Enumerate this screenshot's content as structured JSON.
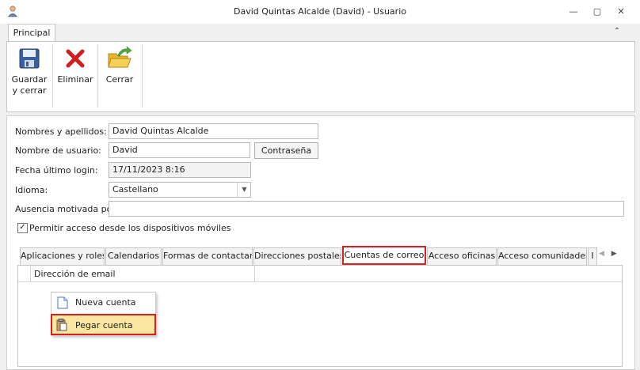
{
  "window": {
    "title": "David Quintas Alcalde (David) - Usuario",
    "minimize_icon": "minimize-icon",
    "restore_icon": "restore-icon",
    "close_icon": "close-icon"
  },
  "ribbon": {
    "tab": "Principal",
    "buttons": {
      "save_line1": "Guardar",
      "save_line2": "y cerrar",
      "delete": "Eliminar",
      "close": "Cerrar"
    }
  },
  "form": {
    "fullname_label": "Nombres y apellidos:",
    "fullname_value": "David Quintas Alcalde",
    "username_label": "Nombre de usuario:",
    "username_value": "David",
    "password_button": "Contraseña",
    "lastlogin_label": "Fecha último login:",
    "lastlogin_value": "17/11/2023 8:16",
    "language_label": "Idioma:",
    "language_value": "Castellano",
    "absence_label": "Ausencia motivada por:",
    "absence_value": "",
    "mobile_access_label": "Permitir acceso desde los dispositivos móviles",
    "mobile_access_checked": true
  },
  "tabs": [
    {
      "label": "Aplicaciones y roles"
    },
    {
      "label": "Calendarios"
    },
    {
      "label": "Formas de contactar"
    },
    {
      "label": "Direcciones postales"
    },
    {
      "label": "Cuentas de correo"
    },
    {
      "label": "Acceso oficinas"
    },
    {
      "label": "Acceso comunidades"
    },
    {
      "label": "I"
    }
  ],
  "active_tab": "Cuentas de correo",
  "grid": {
    "columns": [
      "Dirección de email"
    ]
  },
  "context_menu": {
    "items": [
      {
        "label": "Nueva cuenta",
        "icon": "new-document-icon"
      },
      {
        "label": "Pegar cuenta",
        "icon": "paste-icon"
      }
    ]
  },
  "colors": {
    "highlight_border": "#d92020",
    "menu_hover": "#fbe7a1"
  }
}
